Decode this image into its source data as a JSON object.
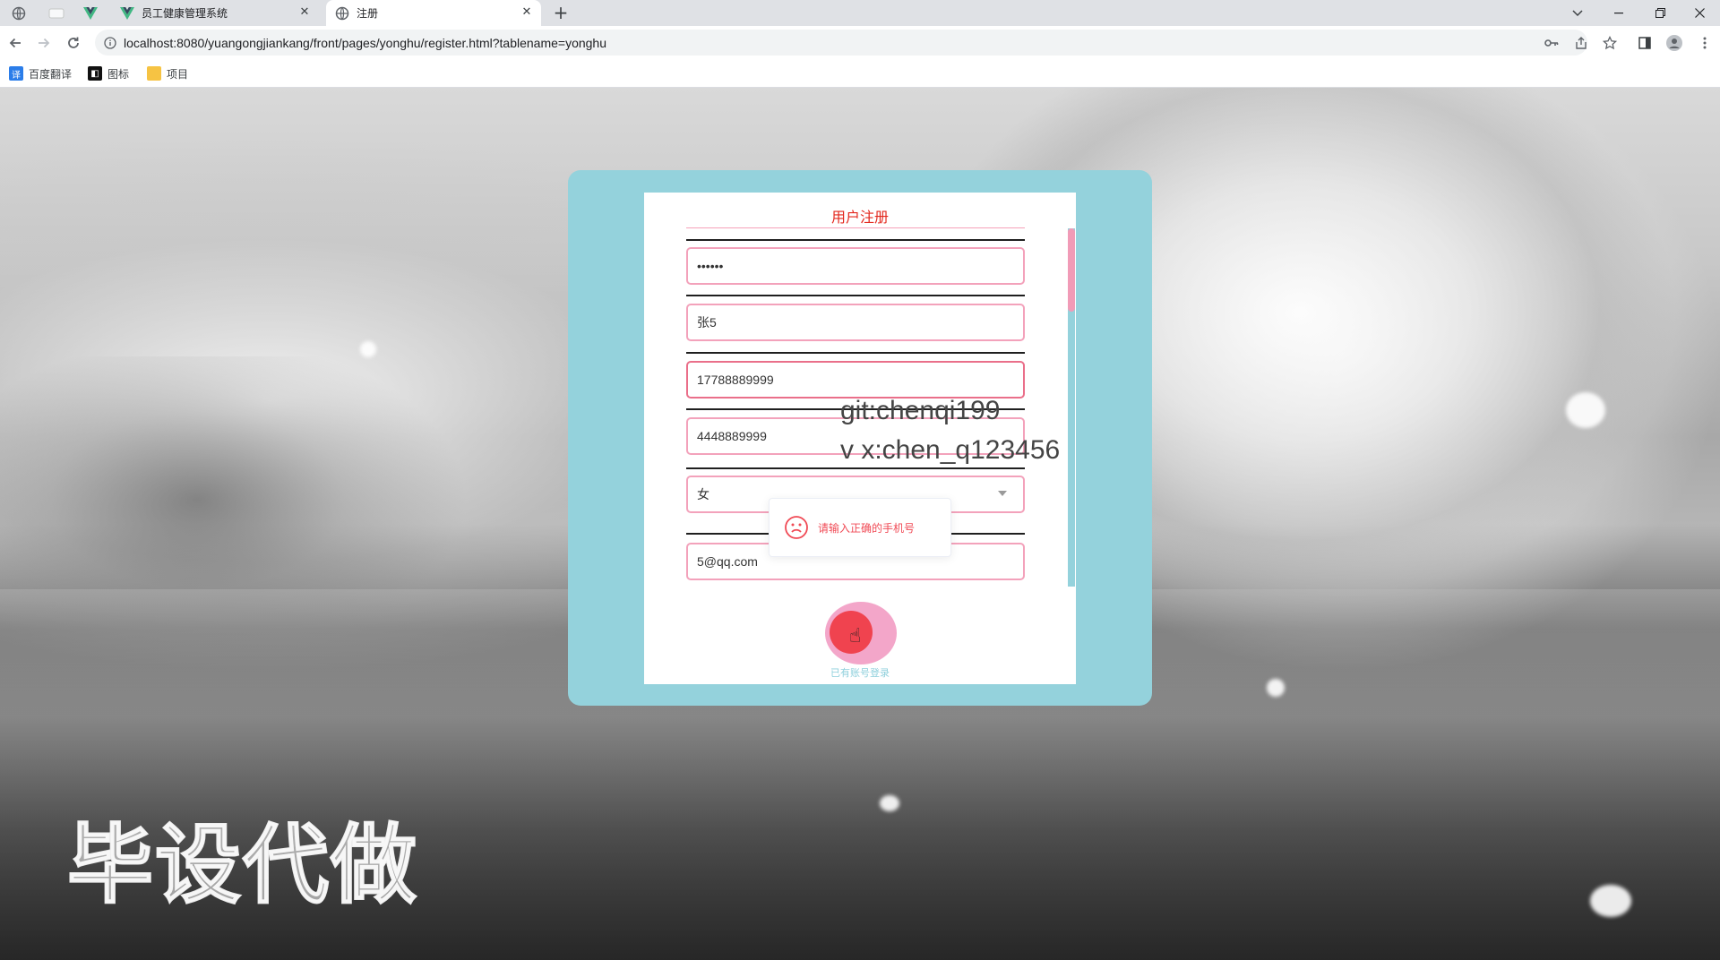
{
  "browser": {
    "tabs": [
      {
        "title": "员工健康管理系统",
        "active": false
      },
      {
        "title": "注册",
        "active": true
      }
    ],
    "url": "localhost:8080/yuangongjiankang/front/pages/yonghu/register.html?tablename=yonghu",
    "bookmarks": [
      {
        "label": "百度翻译"
      },
      {
        "label": "图标"
      },
      {
        "label": "项目"
      }
    ]
  },
  "form": {
    "title": "用户注册",
    "fields": {
      "password": "••••••",
      "name": "张5",
      "phone": "17788889999",
      "id_number": "4448889999",
      "gender": "女",
      "email": "5@qq.com"
    },
    "login_link": "已有账号登录"
  },
  "toast": {
    "message": "请输入正确的手机号"
  },
  "watermarks": {
    "big": "毕设代做",
    "git": "git:chenqi199",
    "vx": "v x:chen_q123456"
  },
  "colors": {
    "card": "#94d2dc",
    "field_border": "#f3a2bb",
    "title": "#e3281e",
    "submit": "#f0434f",
    "error": "#f04a55"
  }
}
